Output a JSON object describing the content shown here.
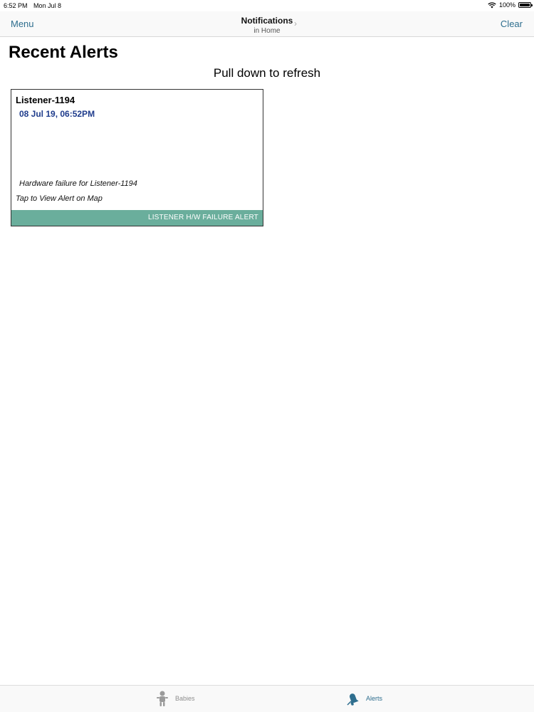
{
  "status_bar": {
    "time": "6:52 PM",
    "date": "Mon Jul 8",
    "battery_pct": "100%"
  },
  "nav": {
    "left_label": "Menu",
    "title": "Notifications",
    "subtitle": "in Home",
    "right_label": "Clear"
  },
  "main": {
    "title": "Recent Alerts",
    "pull_hint": "Pull down to refresh",
    "alerts": [
      {
        "name": "Listener-1194",
        "datetime": "08 Jul 19, 06:52PM",
        "description": "Hardware failure for Listener-1194",
        "tap_hint": "Tap to View Alert on Map",
        "type_label": "LISTENER H/W FAILURE ALERT"
      }
    ]
  },
  "tabs": [
    {
      "label": "Babies",
      "icon": "baby-icon",
      "active": false
    },
    {
      "label": "Alerts",
      "icon": "bell-icon",
      "active": true
    }
  ],
  "colors": {
    "accent": "#2e6e8e",
    "alert_footer": "#6aae9c",
    "date_text": "#1f3c8c"
  }
}
